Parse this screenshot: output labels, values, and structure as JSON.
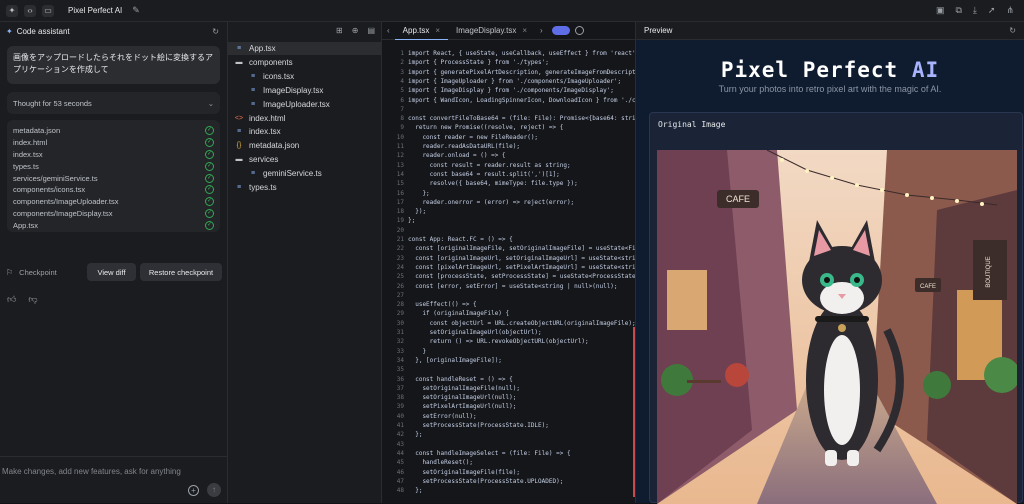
{
  "topbar": {
    "app_name": "Pixel Perfect AI",
    "icons": [
      "sparkle-icon",
      "code-icon",
      "monitor-icon",
      "pencil-icon",
      "save-icon",
      "copy-icon",
      "download-icon",
      "deploy-icon",
      "share-icon"
    ]
  },
  "assistant": {
    "title": "Code assistant",
    "prompt": "画像をアップロードしたらそれをドット絵に変換するアプリケーションを作成して",
    "thought": "Thought for 53 seconds",
    "files": [
      "metadata.json",
      "index.html",
      "index.tsx",
      "types.ts",
      "services/geminiService.ts",
      "components/icons.tsx",
      "components/ImageUploader.tsx",
      "components/ImageDisplay.tsx",
      "App.tsx"
    ],
    "checkpoint_label": "Checkpoint",
    "view_diff": "View diff",
    "restore": "Restore checkpoint",
    "input_placeholder": "Make changes, add new features, ask for anything"
  },
  "tree": [
    {
      "label": "App.tsx",
      "icon": "file-ts-icon",
      "depth": 0,
      "selected": true
    },
    {
      "label": "components",
      "icon": "folder-icon",
      "depth": 0
    },
    {
      "label": "icons.tsx",
      "icon": "file-ts-icon",
      "depth": 1
    },
    {
      "label": "ImageDisplay.tsx",
      "icon": "file-ts-icon",
      "depth": 1
    },
    {
      "label": "ImageUploader.tsx",
      "icon": "file-ts-icon",
      "depth": 1
    },
    {
      "label": "index.html",
      "icon": "file-html-icon",
      "depth": 0
    },
    {
      "label": "index.tsx",
      "icon": "file-ts-icon",
      "depth": 0
    },
    {
      "label": "metadata.json",
      "icon": "file-json-icon",
      "depth": 0
    },
    {
      "label": "services",
      "icon": "folder-icon",
      "depth": 0
    },
    {
      "label": "geminiService.ts",
      "icon": "file-ts-icon",
      "depth": 1
    },
    {
      "label": "types.ts",
      "icon": "file-ts-icon",
      "depth": 0
    }
  ],
  "editor": {
    "tabs": [
      "App.tsx",
      "ImageDisplay.tsx"
    ],
    "lines": [
      {
        "n": "1",
        "t": "import React, { useState, useCallback, useEffect } from 'react';"
      },
      {
        "n": "2",
        "t": "import { ProcessState } from './types';"
      },
      {
        "n": "3",
        "t": "import { generatePixelArtDescription, generateImageFromDescripti"
      },
      {
        "n": "4",
        "t": "import { ImageUploader } from './components/ImageUploader';"
      },
      {
        "n": "5",
        "t": "import { ImageDisplay } from './components/ImageDisplay';"
      },
      {
        "n": "6",
        "t": "import { WandIcon, LoadingSpinnerIcon, DownloadIcon } from './co"
      },
      {
        "n": "7",
        "t": ""
      },
      {
        "n": "8",
        "t": "const convertFileToBase64 = (file: File): Promise<{base64: strin"
      },
      {
        "n": "9",
        "t": "  return new Promise((resolve, reject) => {"
      },
      {
        "n": "10",
        "t": "    const reader = new FileReader();"
      },
      {
        "n": "11",
        "t": "    reader.readAsDataURL(file);"
      },
      {
        "n": "12",
        "t": "    reader.onload = () => {"
      },
      {
        "n": "13",
        "t": "      const result = reader.result as string;"
      },
      {
        "n": "14",
        "t": "      const base64 = result.split(',')[1];"
      },
      {
        "n": "15",
        "t": "      resolve({ base64, mimeType: file.type });"
      },
      {
        "n": "16",
        "t": "    };"
      },
      {
        "n": "17",
        "t": "    reader.onerror = (error) => reject(error);"
      },
      {
        "n": "18",
        "t": "  });"
      },
      {
        "n": "19",
        "t": "};"
      },
      {
        "n": "20",
        "t": ""
      },
      {
        "n": "21",
        "t": "const App: React.FC = () => {"
      },
      {
        "n": "22",
        "t": "  const [originalImageFile, setOriginalImageFile] = useState<Fil"
      },
      {
        "n": "23",
        "t": "  const [originalImageUrl, setOriginalImageUrl] = useState<strin"
      },
      {
        "n": "24",
        "t": "  const [pixelArtImageUrl, setPixelArtImageUrl] = useState<strin"
      },
      {
        "n": "25",
        "t": "  const [processState, setProcessState] = useState<ProcessState>"
      },
      {
        "n": "26",
        "t": "  const [error, setError] = useState<string | null>(null);"
      },
      {
        "n": "27",
        "t": ""
      },
      {
        "n": "28",
        "t": "  useEffect(() => {"
      },
      {
        "n": "29",
        "t": "    if (originalImageFile) {"
      },
      {
        "n": "30",
        "t": "      const objectUrl = URL.createObjectURL(originalImageFile);"
      },
      {
        "n": "31",
        "t": "      setOriginalImageUrl(objectUrl);"
      },
      {
        "n": "32",
        "t": "      return () => URL.revokeObjectURL(objectUrl);"
      },
      {
        "n": "33",
        "t": "    }"
      },
      {
        "n": "34",
        "t": "  }, [originalImageFile]);"
      },
      {
        "n": "35",
        "t": ""
      },
      {
        "n": "36",
        "t": "  const handleReset = () => {"
      },
      {
        "n": "37",
        "t": "    setOriginalImageFile(null);"
      },
      {
        "n": "38",
        "t": "    setOriginalImageUrl(null);"
      },
      {
        "n": "39",
        "t": "    setPixelArtImageUrl(null);"
      },
      {
        "n": "40",
        "t": "    setError(null);"
      },
      {
        "n": "41",
        "t": "    setProcessState(ProcessState.IDLE);"
      },
      {
        "n": "42",
        "t": "  };"
      },
      {
        "n": "43",
        "t": ""
      },
      {
        "n": "44",
        "t": "  const handleImageSelect = (file: File) => {"
      },
      {
        "n": "45",
        "t": "    handleReset();"
      },
      {
        "n": "46",
        "t": "    setOriginalImageFile(file);"
      },
      {
        "n": "47",
        "t": "    setProcessState(ProcessState.UPLOADED);"
      },
      {
        "n": "48",
        "t": "  };"
      }
    ]
  },
  "preview": {
    "header": "Preview",
    "title_main": "Pixel Perfect ",
    "title_ai": "AI",
    "subtitle": "Turn your photos into retro pixel art with the magic of AI.",
    "card_title": "Original Image",
    "signs": [
      "CAFE",
      "BOUTIQUE",
      "CAFE"
    ]
  }
}
